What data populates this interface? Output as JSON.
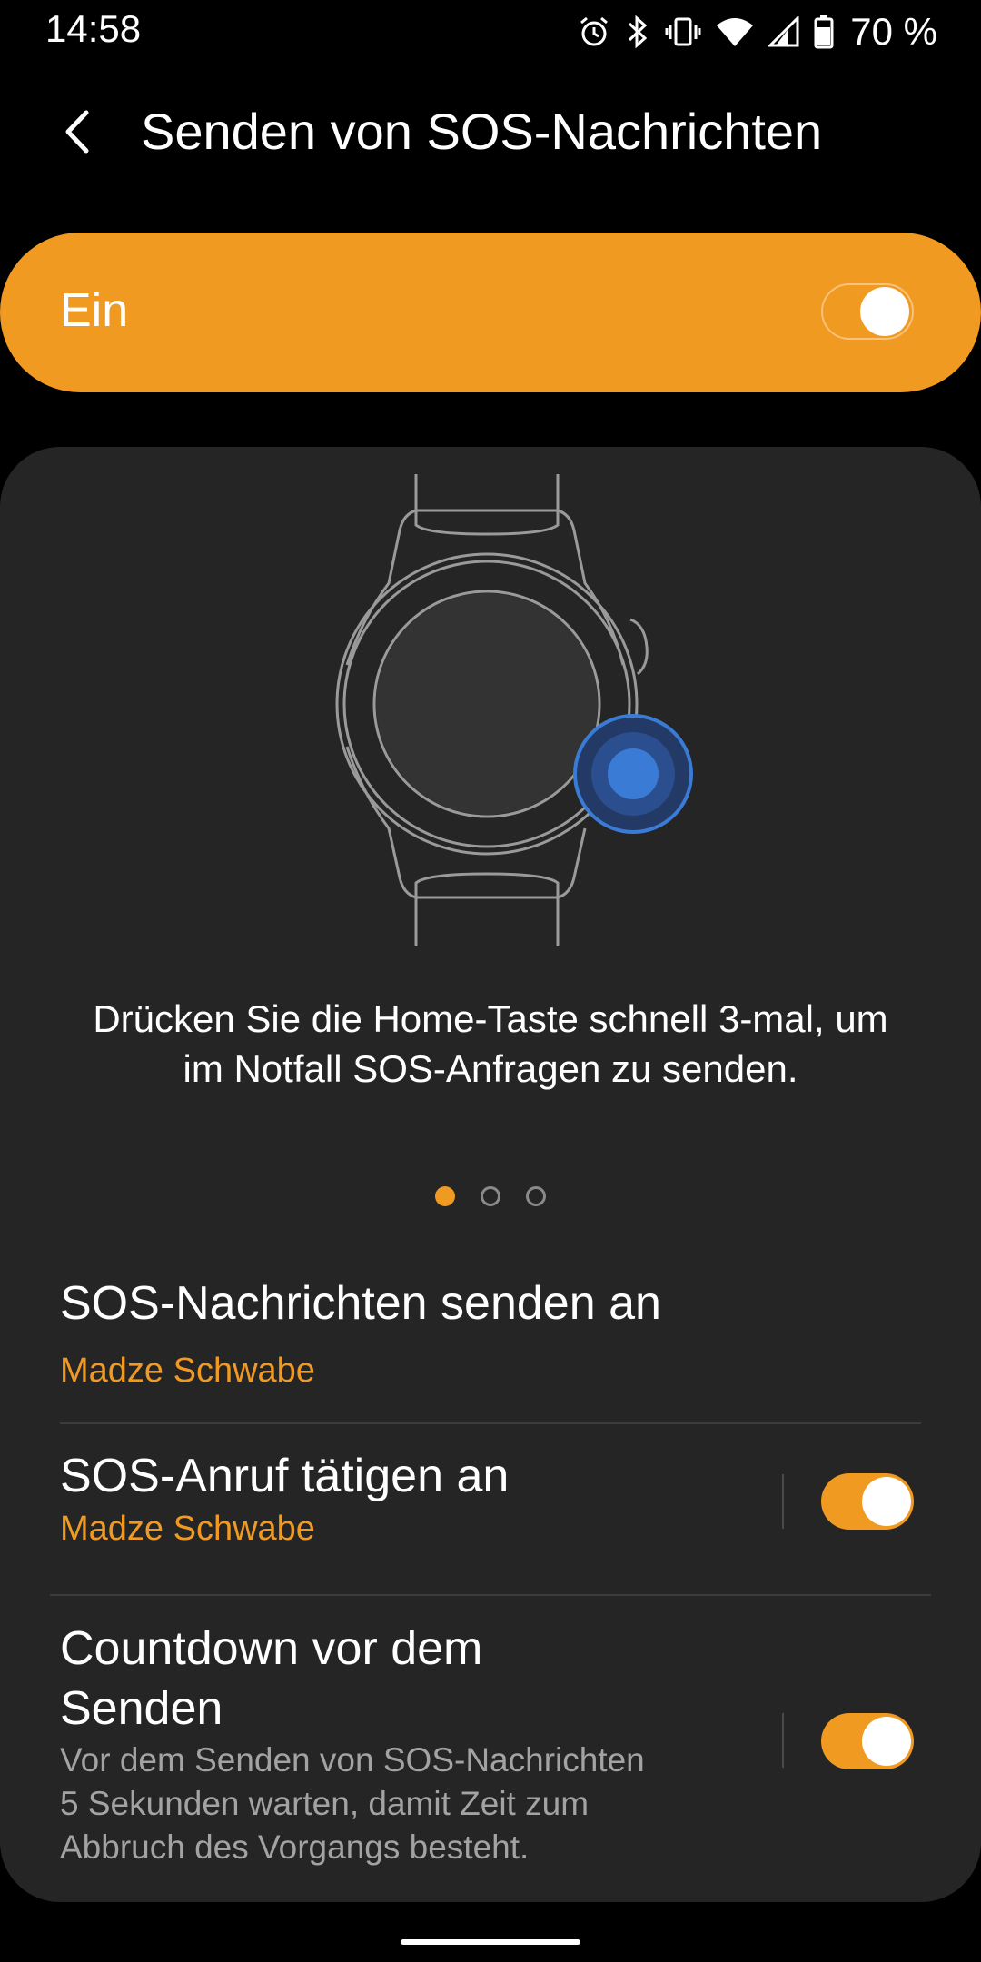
{
  "status_bar": {
    "time": "14:58",
    "battery_percent": "70 %",
    "icons": [
      "alarm-icon",
      "bluetooth-icon",
      "vibrate-icon",
      "wifi-icon",
      "signal-icon",
      "battery-icon"
    ]
  },
  "header": {
    "back_icon": "chevron-left-icon",
    "title": "Senden von SOS-Nachrichten"
  },
  "master_switch": {
    "label": "Ein",
    "on": true
  },
  "tutorial": {
    "illustration": "watch-home-button-illustration",
    "text": "Drücken Sie die Home-Taste schnell 3-mal, um im Notfall SOS-Anfragen zu senden.",
    "pages": 3,
    "current_page": 1
  },
  "settings": {
    "send_to": {
      "title": "SOS-Nachrichten senden an",
      "value": "Madze Schwabe"
    },
    "call": {
      "title": "SOS-Anruf tätigen an",
      "value": "Madze Schwabe",
      "on": true
    },
    "countdown": {
      "title_line1": "Countdown vor dem",
      "title_line2": "Senden",
      "description_line1": "Vor dem Senden von SOS-Nachrichten",
      "description_line2": "5 Sekunden warten, damit Zeit zum",
      "description_line3": "Abbruch des Vorgangs besteht.",
      "on": true
    }
  },
  "colors": {
    "accent": "#f19a22",
    "background": "#000000",
    "card": "#252525",
    "highlight_blue": "#3a7bd5"
  }
}
